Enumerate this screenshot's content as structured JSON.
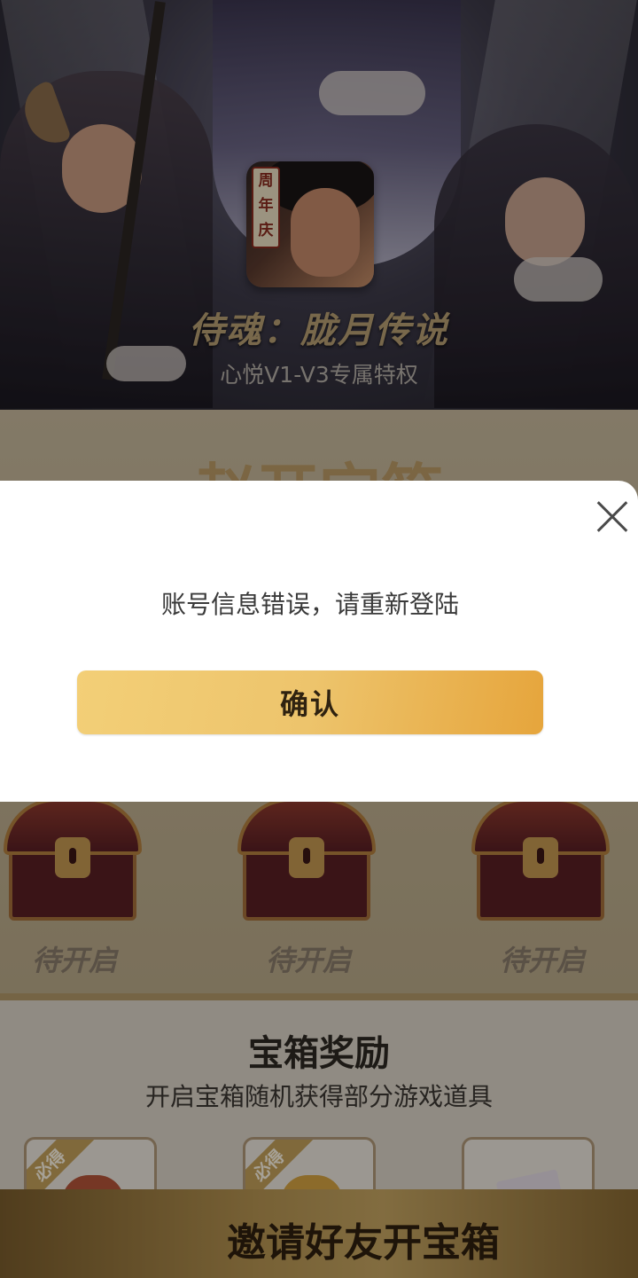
{
  "header": {
    "game_title": "侍魂：胧月传说",
    "subtitle": "心悦V1-V3专属特权",
    "icon_badge": "周年庆"
  },
  "chest_section": {
    "heading": "赵开宝箱",
    "chests": [
      {
        "status": "待开启"
      },
      {
        "status": "待开启"
      },
      {
        "status": "待开启"
      }
    ]
  },
  "rewards": {
    "title": "宝箱奖励",
    "description": "开启宝箱随机获得部分游戏道具",
    "cards": [
      {
        "ribbon": "必得"
      },
      {
        "ribbon": "必得"
      },
      {
        "ribbon": ""
      }
    ]
  },
  "invite_button": {
    "label": "邀请好友开宝箱"
  },
  "dialog": {
    "message": "账号信息错误，请重新登陆",
    "confirm_label": "确认"
  },
  "colors": {
    "accent_gold": "#e6a53c",
    "dialog_bg": "#ffffff",
    "invite_bar": "#b79552"
  },
  "icons": [
    "close-icon",
    "treasure-chest-icon",
    "app-icon"
  ]
}
